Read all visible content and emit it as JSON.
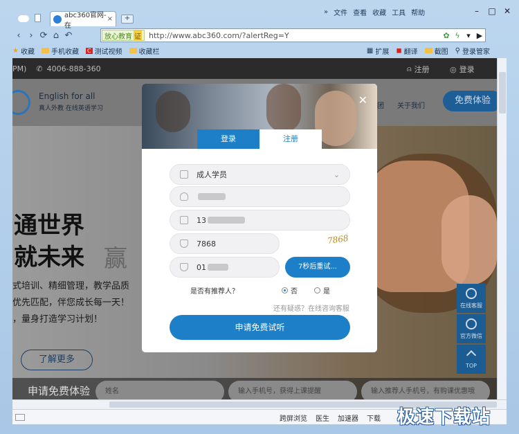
{
  "browser": {
    "tab_title": "abc360官网-在",
    "tab_close": "×",
    "new_tab": "+",
    "menu": [
      "文件",
      "查看",
      "收藏",
      "工具",
      "帮助"
    ],
    "window_buttons": [
      "–",
      "□",
      "✕"
    ],
    "safety_badge": "放心教育",
    "cert_badge": "证",
    "url": "http://www.abc360.com/?alertReg=Y",
    "bookmarks": [
      "收藏",
      "手机收藏",
      "测试视频",
      "收藏栏"
    ],
    "bookmark_right": [
      "扩展",
      "翻译",
      "截图",
      "登录管家"
    ]
  },
  "site": {
    "phone": "4006-888-360",
    "pm": "PM)",
    "register": "注册",
    "login": "登录",
    "brand_en": "English for all",
    "brand_sub": "真人外教 在线英语学习",
    "nav_class": "团",
    "nav_about": "关于我们",
    "free_trial": "免费体验",
    "slogan_line1": "通世界",
    "slogan_line2": "就未来",
    "slogan_right": "赢",
    "desc_line1": "式培训、精细管理，教学品质",
    "desc_line2": "优先匹配，伴您成长每一天！",
    "desc_line3": "，量身打造学习计划！",
    "learn_more": "了解更多",
    "apply_title": "申请免费体验",
    "apply_name_ph": "姓名",
    "apply_phone_ph": "输入手机号，获得上课提醒",
    "apply_ref_ph": "输入推荐人手机号，有购课优惠哦",
    "widget_service": "在线客服",
    "widget_wechat": "官方微信",
    "widget_top": "TOP"
  },
  "modal": {
    "close": "✕",
    "tab_login": "登录",
    "tab_register": "注册",
    "student_type": "成人学员",
    "phone_prefix": "13",
    "captcha_value": "7868",
    "captcha_image": "7868",
    "sms_prefix": "01",
    "retry_label": "7秒后重试...",
    "referrer_question": "是否有推荐人？",
    "option_no": "否",
    "option_yes": "是",
    "consult_link": "还有疑惑？在线咨询客服",
    "submit_label": "申请免费试听"
  },
  "status": {
    "items": [
      "跨屏浏览",
      "医生",
      "加速器",
      "下载"
    ],
    "watermark": "极速下载站"
  }
}
